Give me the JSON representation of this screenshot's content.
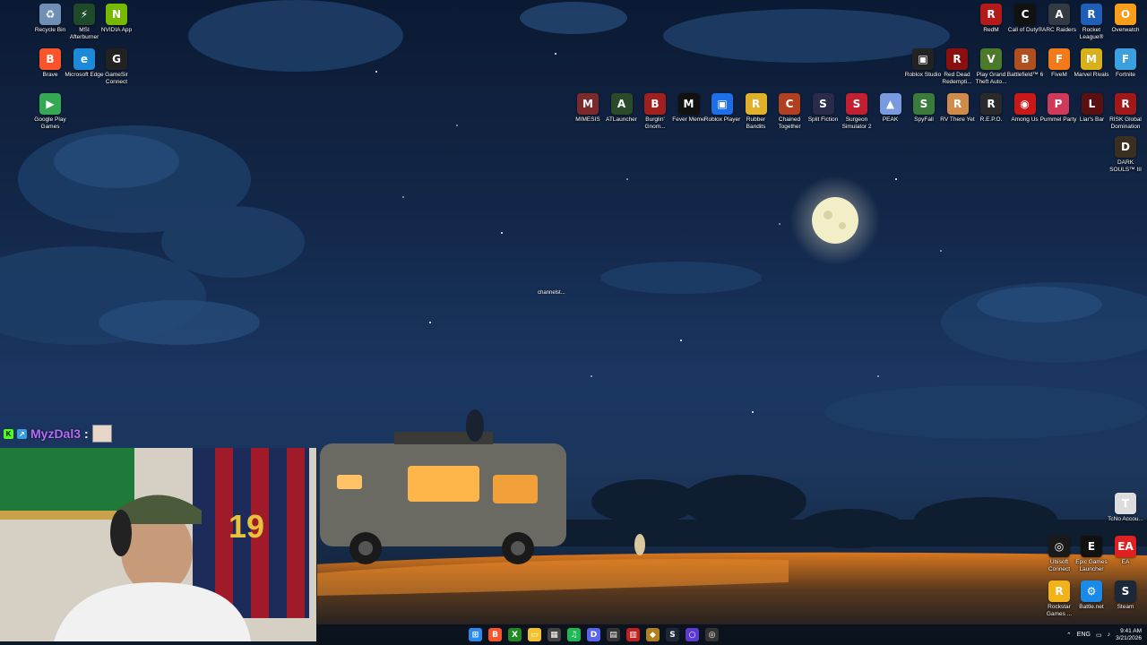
{
  "desktop_icons": {
    "left": [
      {
        "label": "Recycle Bin",
        "icon": "recycle-bin-icon",
        "color": "#6f8fb5",
        "glyph": "♻"
      },
      {
        "label": "MSI Afterburner",
        "icon": "afterburner-icon",
        "color": "#1e4a2a",
        "glyph": "⚡"
      },
      {
        "label": "NVIDIA App",
        "icon": "nvidia-icon",
        "color": "#76b900",
        "glyph": "N"
      },
      {
        "label": "Brave",
        "icon": "brave-icon",
        "color": "#fb542b",
        "glyph": "B"
      },
      {
        "label": "Microsoft Edge",
        "icon": "edge-icon",
        "color": "#1a8ad9",
        "glyph": "e"
      },
      {
        "label": "GameSir Connect",
        "icon": "gamesir-icon",
        "color": "#222222",
        "glyph": "G"
      },
      {
        "label": "Google Play Games",
        "icon": "google-play-games-icon",
        "color": "#34a853",
        "glyph": "▶"
      }
    ],
    "top_right_row1": [
      {
        "label": "RedM",
        "icon": "redm-icon",
        "color": "#b31b1b",
        "glyph": "R"
      },
      {
        "label": "Call of Duty®",
        "icon": "call-of-duty-icon",
        "color": "#111111",
        "glyph": "C"
      },
      {
        "label": "ARC Raiders",
        "icon": "arc-raiders-icon",
        "color": "#333a44",
        "glyph": "A"
      },
      {
        "label": "Rocket League®",
        "icon": "rocket-league-icon",
        "color": "#1f5fb8",
        "glyph": "R"
      },
      {
        "label": "Overwatch",
        "icon": "overwatch-icon",
        "color": "#f99e1a",
        "glyph": "O"
      }
    ],
    "top_right_row2": [
      {
        "label": "Roblox Studio",
        "icon": "roblox-studio-icon",
        "color": "#222222",
        "glyph": "▣"
      },
      {
        "label": "Red Dead Redempti...",
        "icon": "red-dead-icon",
        "color": "#8a1010",
        "glyph": "R"
      },
      {
        "label": "Play Grand Theft Auto...",
        "icon": "gta-icon",
        "color": "#4a7a2a",
        "glyph": "V"
      },
      {
        "label": "Battlefield™ 6",
        "icon": "battlefield-icon",
        "color": "#b05020",
        "glyph": "B"
      },
      {
        "label": "FiveM",
        "icon": "fivem-icon",
        "color": "#f27a1a",
        "glyph": "F"
      },
      {
        "label": "Marvel Rivals",
        "icon": "marvel-rivals-icon",
        "color": "#d8b11a",
        "glyph": "M"
      },
      {
        "label": "Fortnite",
        "icon": "fortnite-icon",
        "color": "#3aa0e0",
        "glyph": "F"
      }
    ],
    "top_right_row3": [
      {
        "label": "MIMESIS",
        "icon": "mimesis-icon",
        "color": "#7a2a2a",
        "glyph": "M"
      },
      {
        "label": "ATLauncher",
        "icon": "atlauncher-icon",
        "color": "#2a4a2a",
        "glyph": "A"
      },
      {
        "label": "Burglin' Gnom...",
        "icon": "burglin-gnomes-icon",
        "color": "#a02020",
        "glyph": "B"
      },
      {
        "label": "Fever Meme",
        "icon": "fever-meme-icon",
        "color": "#111111",
        "glyph": "M"
      },
      {
        "label": "Roblox Player",
        "icon": "roblox-player-icon",
        "color": "#1e6ee8",
        "glyph": "▣"
      },
      {
        "label": "Rubber Bandits",
        "icon": "rubber-bandits-icon",
        "color": "#e0b02a",
        "glyph": "R"
      },
      {
        "label": "Chained Together",
        "icon": "chained-together-icon",
        "color": "#b04020",
        "glyph": "C"
      },
      {
        "label": "Split Fiction",
        "icon": "split-fiction-icon",
        "color": "#2a2a4a",
        "glyph": "S"
      },
      {
        "label": "Surgeon Simulator 2",
        "icon": "surgeon-sim-icon",
        "color": "#c02030",
        "glyph": "S"
      },
      {
        "label": "PEAK",
        "icon": "peak-icon",
        "color": "#7a9ae0",
        "glyph": "▲"
      },
      {
        "label": "SpyFall",
        "icon": "spyfall-icon",
        "color": "#3a7a3a",
        "glyph": "S"
      },
      {
        "label": "RV There Yet",
        "icon": "rv-there-yet-icon",
        "color": "#d08a4a",
        "glyph": "R"
      },
      {
        "label": "R.E.P.O.",
        "icon": "repo-icon",
        "color": "#2a2a2a",
        "glyph": "R"
      },
      {
        "label": "Among Us",
        "icon": "among-us-icon",
        "color": "#c81818",
        "glyph": "◉"
      },
      {
        "label": "Pummel Party",
        "icon": "pummel-party-icon",
        "color": "#d03a5a",
        "glyph": "P"
      },
      {
        "label": "Liar's Bar",
        "icon": "liars-bar-icon",
        "color": "#5a1010",
        "glyph": "L"
      },
      {
        "label": "RISK Global Domination",
        "icon": "risk-icon",
        "color": "#a01818",
        "glyph": "R"
      }
    ],
    "top_right_extra": [
      {
        "label": "DARK SOULS™ III",
        "icon": "dark-souls-icon",
        "color": "#3a3020",
        "glyph": "D"
      }
    ],
    "bottom_right": [
      {
        "label": "TcNo Accou...",
        "icon": "tcno-icon",
        "color": "#dddddd",
        "glyph": "T"
      },
      {
        "label": "Ubisoft Connect",
        "icon": "ubisoft-icon",
        "color": "#1a1a1a",
        "glyph": "◎"
      },
      {
        "label": "Epic Games Launcher",
        "icon": "epic-games-icon",
        "color": "#111111",
        "glyph": "E"
      },
      {
        "label": "EA",
        "icon": "ea-icon",
        "color": "#e02020",
        "glyph": "EA"
      },
      {
        "label": "Rockstar Games ...",
        "icon": "rockstar-icon",
        "color": "#f2b21a",
        "glyph": "R"
      },
      {
        "label": "Battle.net",
        "icon": "battlenet-icon",
        "color": "#1a8ae8",
        "glyph": "⚙"
      },
      {
        "label": "Steam",
        "icon": "steam-icon",
        "color": "#1b2838",
        "glyph": "S"
      }
    ],
    "center_label": "channelst..."
  },
  "chat": {
    "username": "MyzDal3",
    "colon": ":"
  },
  "taskbar": {
    "buttons": [
      {
        "icon": "windows-start-icon",
        "color": "#2a8af0",
        "glyph": "⊞"
      },
      {
        "icon": "brave-icon",
        "color": "#fb542b",
        "glyph": "B"
      },
      {
        "icon": "xbox-icon",
        "color": "#1f8a1f",
        "glyph": "X"
      },
      {
        "icon": "file-explorer-icon",
        "color": "#f2c230",
        "glyph": "▭"
      },
      {
        "icon": "calculator-icon",
        "color": "#444444",
        "glyph": "▦"
      },
      {
        "icon": "spotify-icon",
        "color": "#1db954",
        "glyph": "♫"
      },
      {
        "icon": "discord-icon",
        "color": "#5865f2",
        "glyph": "D"
      },
      {
        "icon": "app-icon",
        "color": "#333333",
        "glyph": "▤"
      },
      {
        "icon": "calendar-icon",
        "color": "#c02020",
        "glyph": "▥"
      },
      {
        "icon": "shield-icon",
        "color": "#b08020",
        "glyph": "◆"
      },
      {
        "icon": "steam-icon",
        "color": "#1b2838",
        "glyph": "S"
      },
      {
        "icon": "cortana-icon",
        "color": "#5a3ad0",
        "glyph": "○"
      },
      {
        "icon": "obs-icon",
        "color": "#333333",
        "glyph": "◎"
      }
    ],
    "tray": {
      "language": "ENG",
      "time": "9:41 AM",
      "date": "3/21/2026"
    }
  }
}
